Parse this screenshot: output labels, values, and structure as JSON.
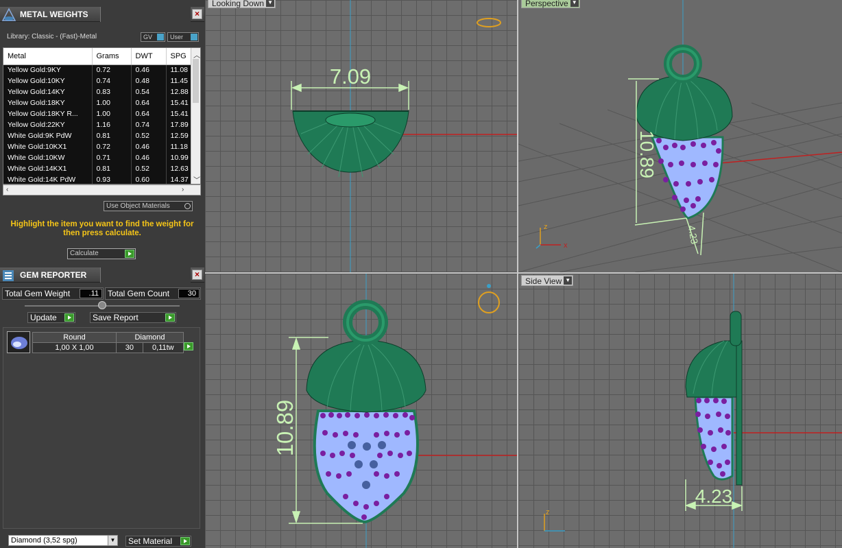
{
  "metal_weights": {
    "title": "METAL WEIGHTS",
    "library": "Library: Classic - (Fast)-Metal",
    "gv_button": "GV",
    "user_button": "User",
    "columns": [
      "Metal",
      "Grams",
      "DWT",
      "SPG"
    ],
    "rows": [
      [
        "Yellow Gold:9KY",
        "0.72",
        "0.46",
        "11.08"
      ],
      [
        "Yellow Gold:10KY",
        "0.74",
        "0.48",
        "11.45"
      ],
      [
        "Yellow Gold:14KY",
        "0.83",
        "0.54",
        "12.88"
      ],
      [
        "Yellow Gold:18KY",
        "1.00",
        "0.64",
        "15.41"
      ],
      [
        "Yellow Gold:18KY R...",
        "1.00",
        "0.64",
        "15.41"
      ],
      [
        "Yellow Gold:22KY",
        "1.16",
        "0.74",
        "17.89"
      ],
      [
        "White Gold:9K PdW",
        "0.81",
        "0.52",
        "12.59"
      ],
      [
        "White Gold:10KX1",
        "0.72",
        "0.46",
        "11.18"
      ],
      [
        "White Gold:10KW",
        "0.71",
        "0.46",
        "10.99"
      ],
      [
        "White Gold:14KX1",
        "0.81",
        "0.52",
        "12.63"
      ],
      [
        "White Gold:14K PdW",
        "0.93",
        "0.60",
        "14.37"
      ]
    ],
    "use_object_materials": "Use Object Materials",
    "hint": "Highlight the item you want to find the weight for then press calculate.",
    "calculate_button": "Calculate"
  },
  "gem_reporter": {
    "title": "GEM REPORTER",
    "total_weight_label": "Total Gem Weight",
    "total_weight_value": ".11",
    "total_count_label": "Total Gem Count",
    "total_count_value": "30",
    "update_button": "Update",
    "save_report_button": "Save Report",
    "gem": {
      "shape": "Round",
      "material": "Diamond",
      "size": "1,00 X 1,00",
      "count": "30",
      "weight": "0,11tw"
    },
    "material_select": "Diamond     (3,52 spg)",
    "set_material_button": "Set Material"
  },
  "viewports": {
    "top_left_label": "Looking Down",
    "top_right_label": "Perspective",
    "bottom_right_label": "Side View",
    "dim_top": "7.09",
    "dim_front": "10.89",
    "dim_persp_height": "10.89",
    "dim_persp_depth": "4.23",
    "dim_side": "4.23",
    "axis_z": "z",
    "axis_x": "x"
  },
  "colors": {
    "metal_green": "#1f7a55",
    "gem_blue": "#9fb8ff",
    "gem_purple": "#7a1fa0",
    "dimension_green": "#c8f2b4",
    "axis_red": "#c02020",
    "axis_blue": "#3aa0c8",
    "hint_yellow": "#f5c518"
  }
}
